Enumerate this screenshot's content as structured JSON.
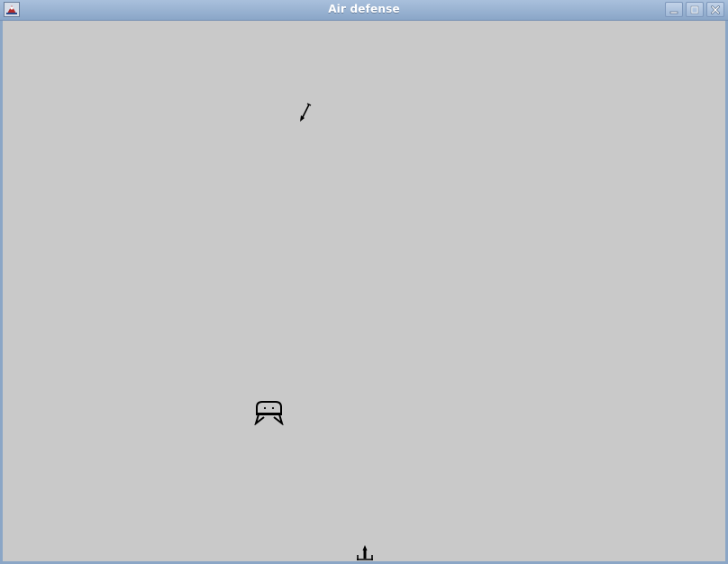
{
  "window": {
    "title": "Air defense"
  },
  "icons": {
    "app": "java-app-icon",
    "minimize": "minimize-icon",
    "maximize": "maximize-icon",
    "close": "close-icon"
  },
  "game": {
    "background_color": "#c9c9c9",
    "sprite_color": "#000000",
    "objects": [
      "falling-missile",
      "enemy-ufo",
      "player-turret"
    ]
  }
}
